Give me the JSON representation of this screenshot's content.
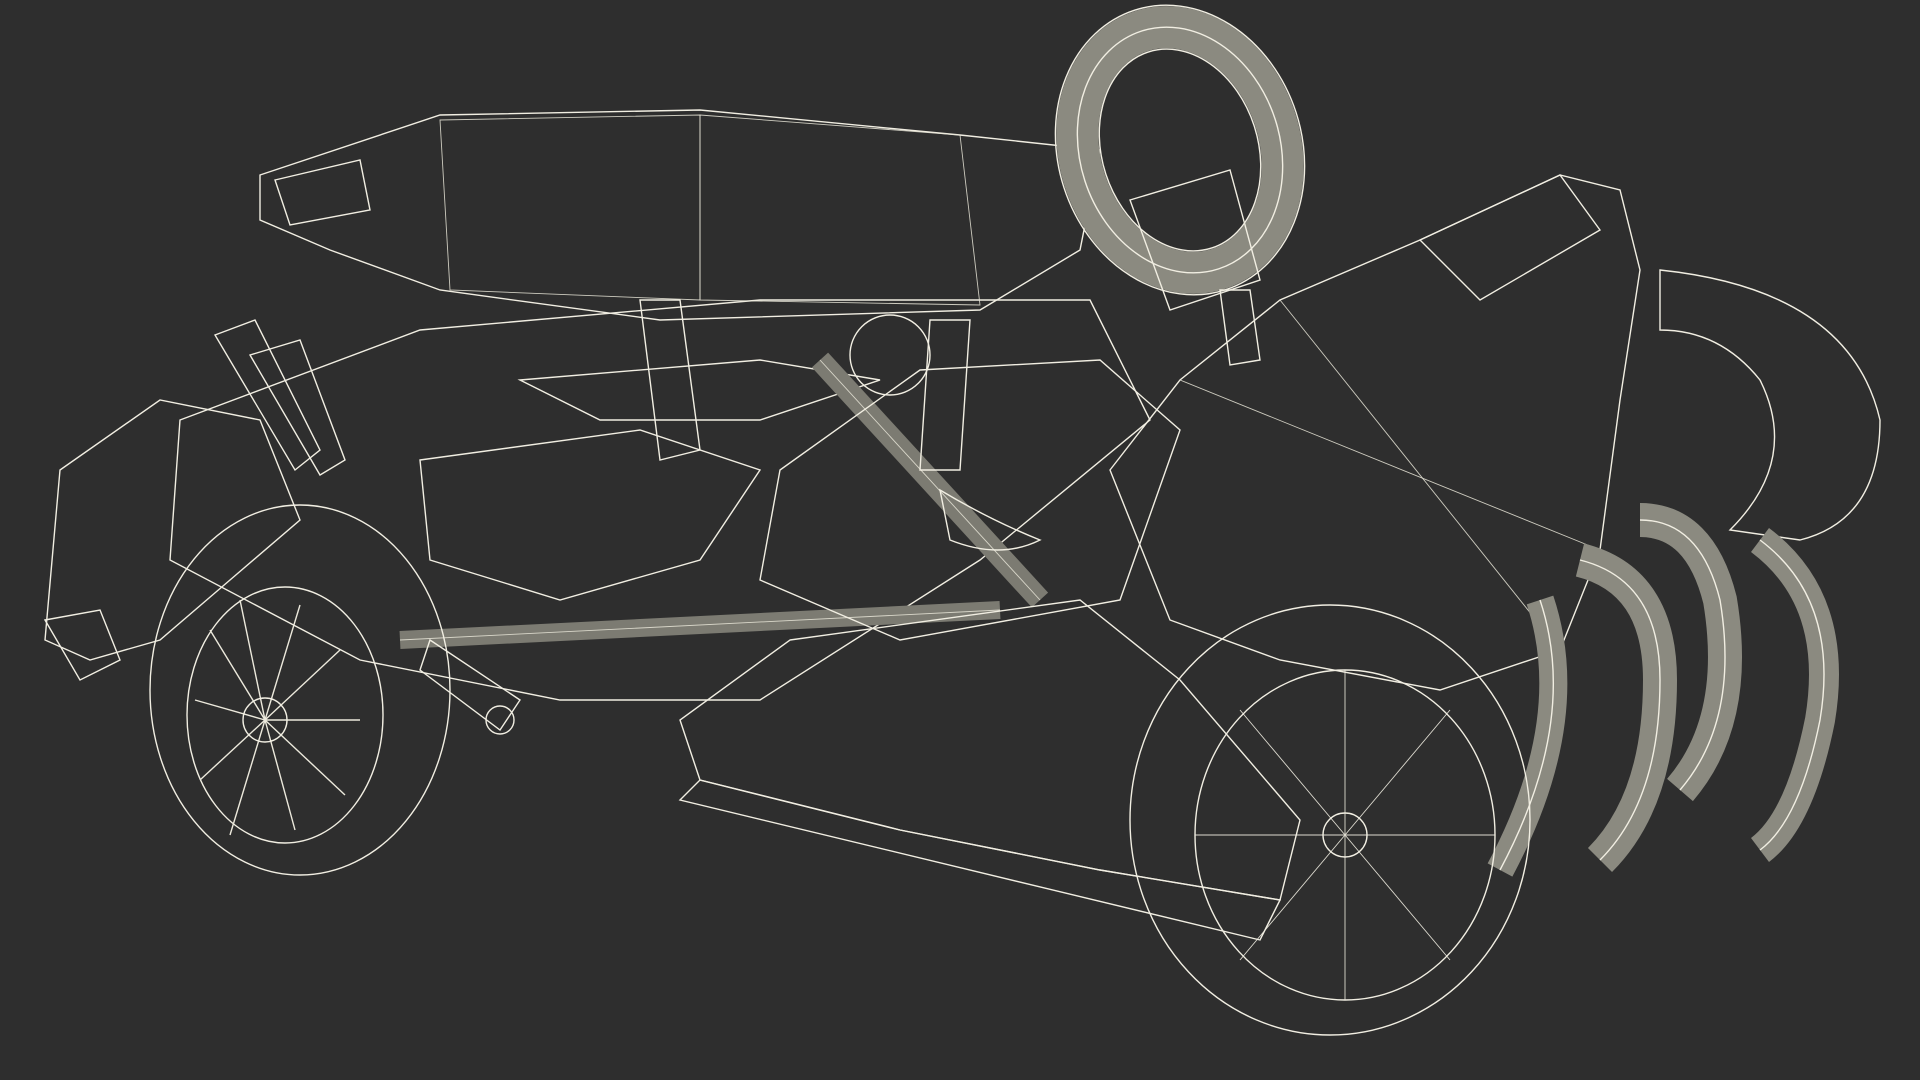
{
  "scene": {
    "subject": "go-kart-wireframe-model",
    "background_color": "#2e2e2e",
    "surface_color": "#8b8a80",
    "wire_color": "#f1eee2"
  }
}
